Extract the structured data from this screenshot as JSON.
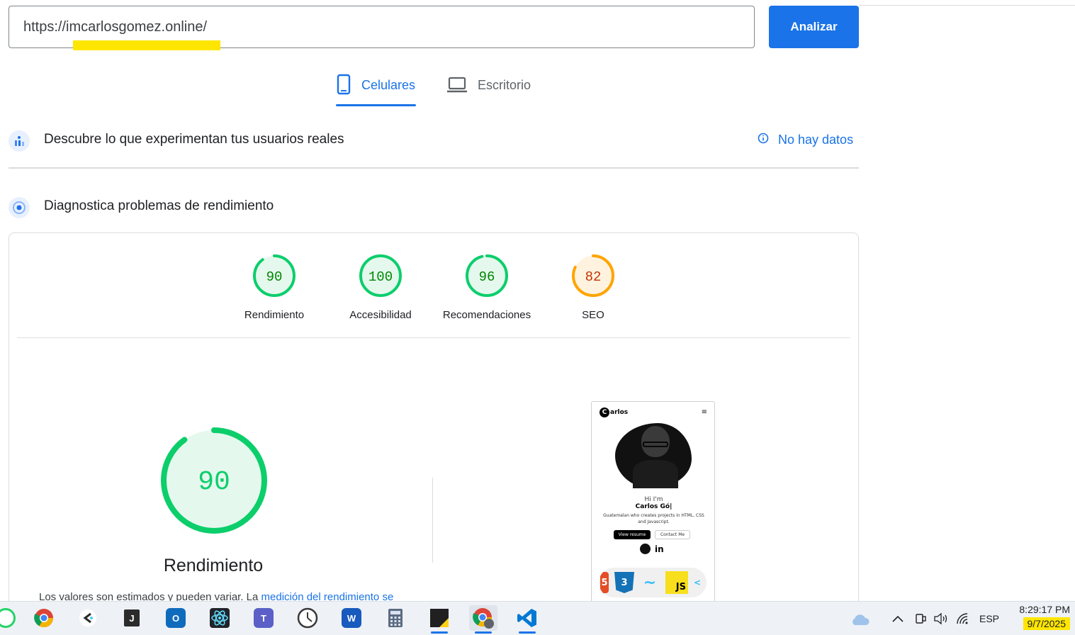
{
  "url_input": {
    "value": "https://imcarlosgomez.online/"
  },
  "analyze_button": {
    "label": "Analizar"
  },
  "tabs": [
    {
      "label": "Celulares",
      "icon": "smartphone-icon",
      "active": true
    },
    {
      "label": "Escritorio",
      "icon": "laptop-icon",
      "active": false
    }
  ],
  "field_data": {
    "title": "Descubre lo que experimentan tus usuarios reales",
    "status": "No hay datos"
  },
  "lab_data": {
    "title": "Diagnostica problemas de rendimiento"
  },
  "scores": [
    {
      "label": "Rendimiento",
      "value": 90,
      "color": "#0cce6b",
      "text_color": "#008800"
    },
    {
      "label": "Accesibilidad",
      "value": 100,
      "color": "#0cce6b",
      "text_color": "#008800"
    },
    {
      "label": "Recomendaciones",
      "value": 96,
      "color": "#0cce6b",
      "text_color": "#008800"
    },
    {
      "label": "SEO",
      "value": 82,
      "color": "#ffa400",
      "text_color": "#c33300"
    }
  ],
  "main_score": {
    "value": 90,
    "label": "Rendimiento",
    "color": "#0cce6b"
  },
  "disclaimer": {
    "text": "Los valores son estimados y pueden variar. La ",
    "link": "medición del rendimiento se"
  },
  "preview": {
    "logo_letter": "C",
    "logo_text": "arlos",
    "menu": "≡",
    "greeting": "Hi I'm",
    "name": "Carlos Gó|",
    "description": "Guatemalan who creates projects in HTML, CSS and Javascript.",
    "primary_button": "View resume",
    "secondary_button": "Contact Me",
    "social_text": "in",
    "skills": [
      "5",
      "3",
      "~",
      "JS",
      "<"
    ]
  },
  "taskbar": {
    "apps": [
      "whatsapp-icon",
      "chrome-icon",
      "clickup-icon",
      "j-app-icon",
      "outlook-icon",
      "react-icon",
      "teams-icon",
      "clock-app-icon",
      "word-icon",
      "calculator-icon",
      "sticky-notes-icon",
      "chrome-profile-icon",
      "vscode-icon"
    ],
    "j_app_letter": "J",
    "outlook_letter": "O",
    "teams_letter": "T",
    "word_letter": "W",
    "language": "ESP",
    "time": "8:29:17 PM",
    "date": "9/7/2025"
  },
  "colors": {
    "accent": "#1a73e8",
    "pass": "#0cce6b",
    "average": "#ffa400"
  }
}
